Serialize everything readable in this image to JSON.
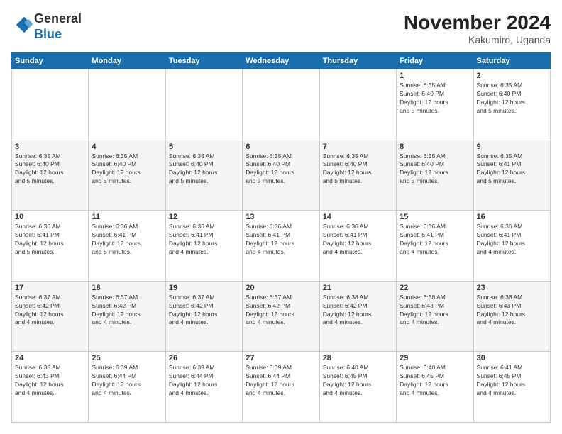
{
  "logo": {
    "general": "General",
    "blue": "Blue"
  },
  "title": "November 2024",
  "location": "Kakumiro, Uganda",
  "days_of_week": [
    "Sunday",
    "Monday",
    "Tuesday",
    "Wednesday",
    "Thursday",
    "Friday",
    "Saturday"
  ],
  "weeks": [
    [
      {
        "day": "",
        "info": ""
      },
      {
        "day": "",
        "info": ""
      },
      {
        "day": "",
        "info": ""
      },
      {
        "day": "",
        "info": ""
      },
      {
        "day": "",
        "info": ""
      },
      {
        "day": "1",
        "info": "Sunrise: 6:35 AM\nSunset: 6:40 PM\nDaylight: 12 hours\nand 5 minutes."
      },
      {
        "day": "2",
        "info": "Sunrise: 6:35 AM\nSunset: 6:40 PM\nDaylight: 12 hours\nand 5 minutes."
      }
    ],
    [
      {
        "day": "3",
        "info": "Sunrise: 6:35 AM\nSunset: 6:40 PM\nDaylight: 12 hours\nand 5 minutes."
      },
      {
        "day": "4",
        "info": "Sunrise: 6:35 AM\nSunset: 6:40 PM\nDaylight: 12 hours\nand 5 minutes."
      },
      {
        "day": "5",
        "info": "Sunrise: 6:35 AM\nSunset: 6:40 PM\nDaylight: 12 hours\nand 5 minutes."
      },
      {
        "day": "6",
        "info": "Sunrise: 6:35 AM\nSunset: 6:40 PM\nDaylight: 12 hours\nand 5 minutes."
      },
      {
        "day": "7",
        "info": "Sunrise: 6:35 AM\nSunset: 6:40 PM\nDaylight: 12 hours\nand 5 minutes."
      },
      {
        "day": "8",
        "info": "Sunrise: 6:35 AM\nSunset: 6:40 PM\nDaylight: 12 hours\nand 5 minutes."
      },
      {
        "day": "9",
        "info": "Sunrise: 6:35 AM\nSunset: 6:41 PM\nDaylight: 12 hours\nand 5 minutes."
      }
    ],
    [
      {
        "day": "10",
        "info": "Sunrise: 6:36 AM\nSunset: 6:41 PM\nDaylight: 12 hours\nand 5 minutes."
      },
      {
        "day": "11",
        "info": "Sunrise: 6:36 AM\nSunset: 6:41 PM\nDaylight: 12 hours\nand 5 minutes."
      },
      {
        "day": "12",
        "info": "Sunrise: 6:36 AM\nSunset: 6:41 PM\nDaylight: 12 hours\nand 4 minutes."
      },
      {
        "day": "13",
        "info": "Sunrise: 6:36 AM\nSunset: 6:41 PM\nDaylight: 12 hours\nand 4 minutes."
      },
      {
        "day": "14",
        "info": "Sunrise: 6:36 AM\nSunset: 6:41 PM\nDaylight: 12 hours\nand 4 minutes."
      },
      {
        "day": "15",
        "info": "Sunrise: 6:36 AM\nSunset: 6:41 PM\nDaylight: 12 hours\nand 4 minutes."
      },
      {
        "day": "16",
        "info": "Sunrise: 6:36 AM\nSunset: 6:41 PM\nDaylight: 12 hours\nand 4 minutes."
      }
    ],
    [
      {
        "day": "17",
        "info": "Sunrise: 6:37 AM\nSunset: 6:42 PM\nDaylight: 12 hours\nand 4 minutes."
      },
      {
        "day": "18",
        "info": "Sunrise: 6:37 AM\nSunset: 6:42 PM\nDaylight: 12 hours\nand 4 minutes."
      },
      {
        "day": "19",
        "info": "Sunrise: 6:37 AM\nSunset: 6:42 PM\nDaylight: 12 hours\nand 4 minutes."
      },
      {
        "day": "20",
        "info": "Sunrise: 6:37 AM\nSunset: 6:42 PM\nDaylight: 12 hours\nand 4 minutes."
      },
      {
        "day": "21",
        "info": "Sunrise: 6:38 AM\nSunset: 6:42 PM\nDaylight: 12 hours\nand 4 minutes."
      },
      {
        "day": "22",
        "info": "Sunrise: 6:38 AM\nSunset: 6:43 PM\nDaylight: 12 hours\nand 4 minutes."
      },
      {
        "day": "23",
        "info": "Sunrise: 6:38 AM\nSunset: 6:43 PM\nDaylight: 12 hours\nand 4 minutes."
      }
    ],
    [
      {
        "day": "24",
        "info": "Sunrise: 6:38 AM\nSunset: 6:43 PM\nDaylight: 12 hours\nand 4 minutes."
      },
      {
        "day": "25",
        "info": "Sunrise: 6:39 AM\nSunset: 6:44 PM\nDaylight: 12 hours\nand 4 minutes."
      },
      {
        "day": "26",
        "info": "Sunrise: 6:39 AM\nSunset: 6:44 PM\nDaylight: 12 hours\nand 4 minutes."
      },
      {
        "day": "27",
        "info": "Sunrise: 6:39 AM\nSunset: 6:44 PM\nDaylight: 12 hours\nand 4 minutes."
      },
      {
        "day": "28",
        "info": "Sunrise: 6:40 AM\nSunset: 6:45 PM\nDaylight: 12 hours\nand 4 minutes."
      },
      {
        "day": "29",
        "info": "Sunrise: 6:40 AM\nSunset: 6:45 PM\nDaylight: 12 hours\nand 4 minutes."
      },
      {
        "day": "30",
        "info": "Sunrise: 6:41 AM\nSunset: 6:45 PM\nDaylight: 12 hours\nand 4 minutes."
      }
    ]
  ]
}
